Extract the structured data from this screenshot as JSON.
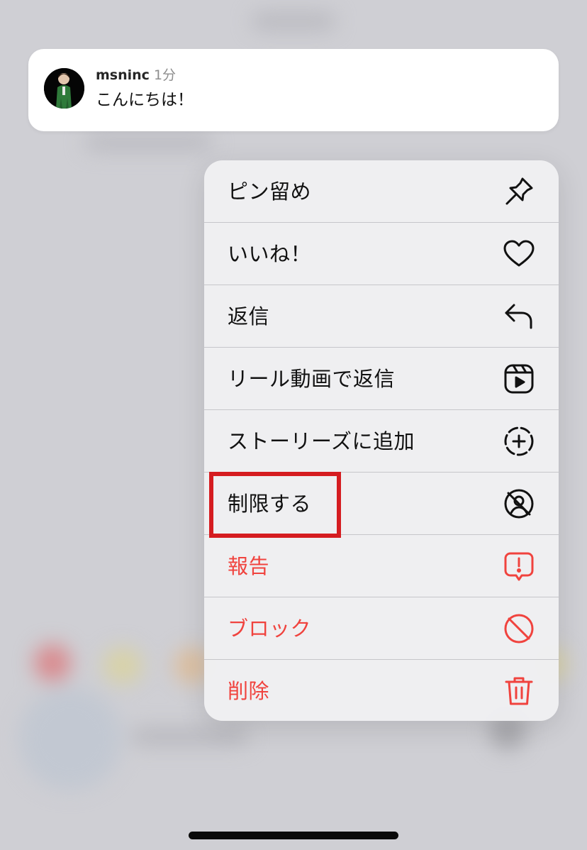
{
  "message": {
    "username": "msninc",
    "time": "1分",
    "text": "こんにちは！"
  },
  "menu": {
    "items": [
      {
        "label": "ピン留め",
        "icon": "pin-icon",
        "danger": false
      },
      {
        "label": "いいね！",
        "icon": "heart-icon",
        "danger": false
      },
      {
        "label": "返信",
        "icon": "reply-icon",
        "danger": false
      },
      {
        "label": "リール動画で返信",
        "icon": "reels-icon",
        "danger": false
      },
      {
        "label": "ストーリーズに追加",
        "icon": "add-story-icon",
        "danger": false
      },
      {
        "label": "制限する",
        "icon": "restrict-icon",
        "danger": false,
        "highlighted": true
      },
      {
        "label": "報告",
        "icon": "report-icon",
        "danger": true
      },
      {
        "label": "ブロック",
        "icon": "block-icon",
        "danger": true
      },
      {
        "label": "削除",
        "icon": "trash-icon",
        "danger": true
      }
    ]
  },
  "colors": {
    "danger": "#f0433e",
    "text": "#111111",
    "highlight": "#d51c20",
    "muted": "#8e8e8e"
  }
}
